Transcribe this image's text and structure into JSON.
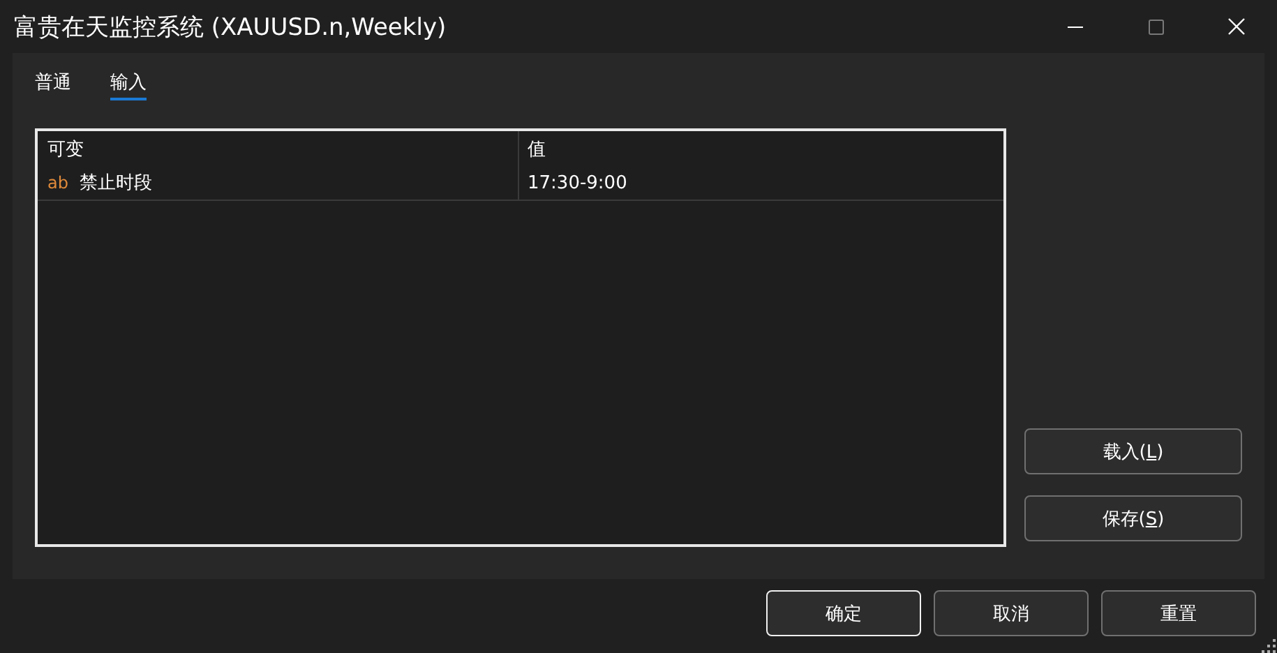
{
  "window": {
    "title": "富贵在天监控系统 (XAUUSD.n,Weekly)",
    "maximize": {
      "disabled": true
    }
  },
  "tabs": [
    {
      "label": "普通",
      "selected": false
    },
    {
      "label": "输入",
      "selected": true
    }
  ],
  "table": {
    "columns": [
      "可变",
      "值"
    ],
    "rows": [
      {
        "kind": "string",
        "type_label": "ab",
        "name": "禁止时段",
        "value": "17:30-9:00"
      }
    ]
  },
  "side_buttons": [
    {
      "before": "载入(",
      "key": "L",
      "after": ")"
    },
    {
      "before": "保存(",
      "key": "S",
      "after": ")"
    }
  ],
  "footer_buttons": [
    {
      "label": "确定",
      "default": true
    },
    {
      "label": "取消",
      "default": false
    },
    {
      "label": "重置",
      "default": false
    }
  ]
}
